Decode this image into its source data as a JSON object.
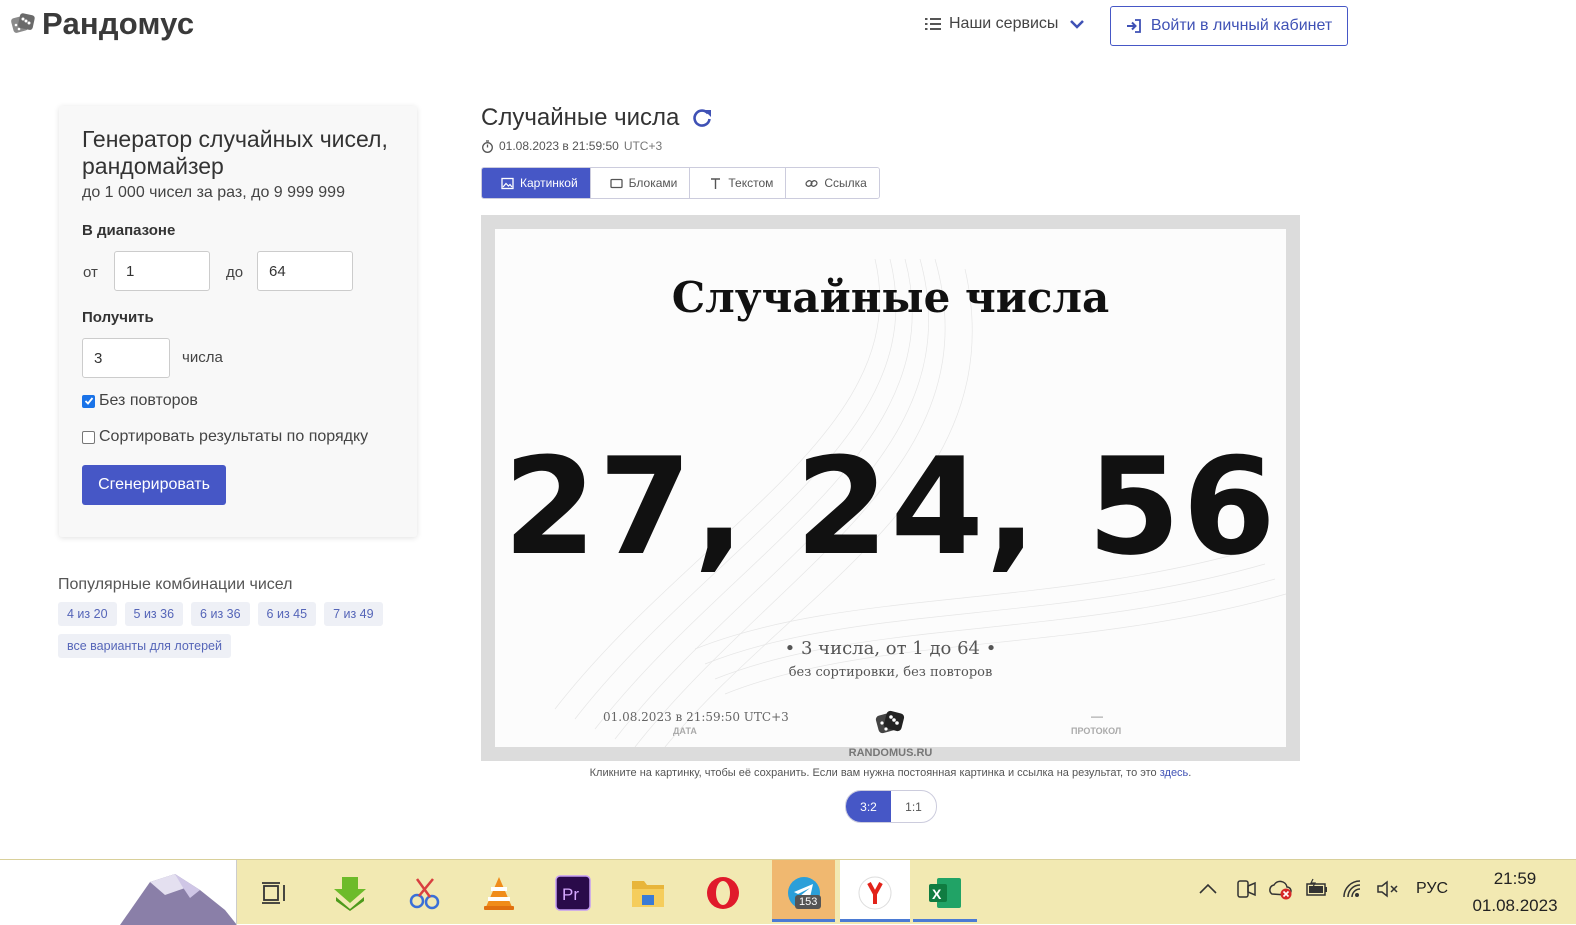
{
  "header": {
    "logo_text": "Рандомус",
    "services_label": "Наши сервисы",
    "login_label": "Войти в личный кабинет"
  },
  "generator": {
    "title": "Генератор случайных чисел, рандомайзер",
    "subtitle": "до 1 000 чисел за раз, до 9 999 999",
    "range_label": "В диапазоне",
    "from_label": "от",
    "from_value": "1",
    "to_label": "до",
    "to_value": "64",
    "get_label": "Получить",
    "count_value": "3",
    "count_unit": "числа",
    "no_repeat_label": "Без повторов",
    "no_repeat_checked": true,
    "sort_label": "Сортировать результаты по порядку",
    "sort_checked": false,
    "generate_button": "Сгенерировать"
  },
  "popular": {
    "title": "Популярные комбинации чисел",
    "chips": [
      "4 из 20",
      "5 из 36",
      "6 из 36",
      "6 из 45",
      "7 из 49",
      "все варианты для лотерей"
    ]
  },
  "result": {
    "title": "Случайные числа",
    "timestamp": "01.08.2023 в 21:59:50",
    "timezone": "UTC+3",
    "tabs": [
      "Картинкой",
      "Блоками",
      "Текстом",
      "Ссылка"
    ],
    "active_tab": "Картинкой"
  },
  "picture": {
    "title": "Случайные числа",
    "numbers": "27, 24, 56",
    "info": "• 3 числа, от 1 до 64 •",
    "info_sub": "без сортировки, без повторов",
    "date": "01.08.2023 в 21:59:50 UTC+3",
    "date_label": "ДАТА",
    "protocol_value": "—",
    "protocol_label": "ПРОТОКОЛ",
    "site": "RANDOMUS.RU"
  },
  "hint": {
    "text": "Кликните на картинку, чтобы её сохранить. Если вам нужна постоянная картинка и ссылка на результат, то это",
    "link": "здесь",
    "end": "."
  },
  "ratio": {
    "options": [
      "3:2",
      "1:1"
    ],
    "active": "3:2"
  },
  "taskbar": {
    "telegram_badge": "153",
    "lang": "РУС",
    "time": "21:59",
    "date": "01.08.2023"
  },
  "colors": {
    "accent": "#4657c6",
    "taskbar": "#f2e9b2"
  }
}
